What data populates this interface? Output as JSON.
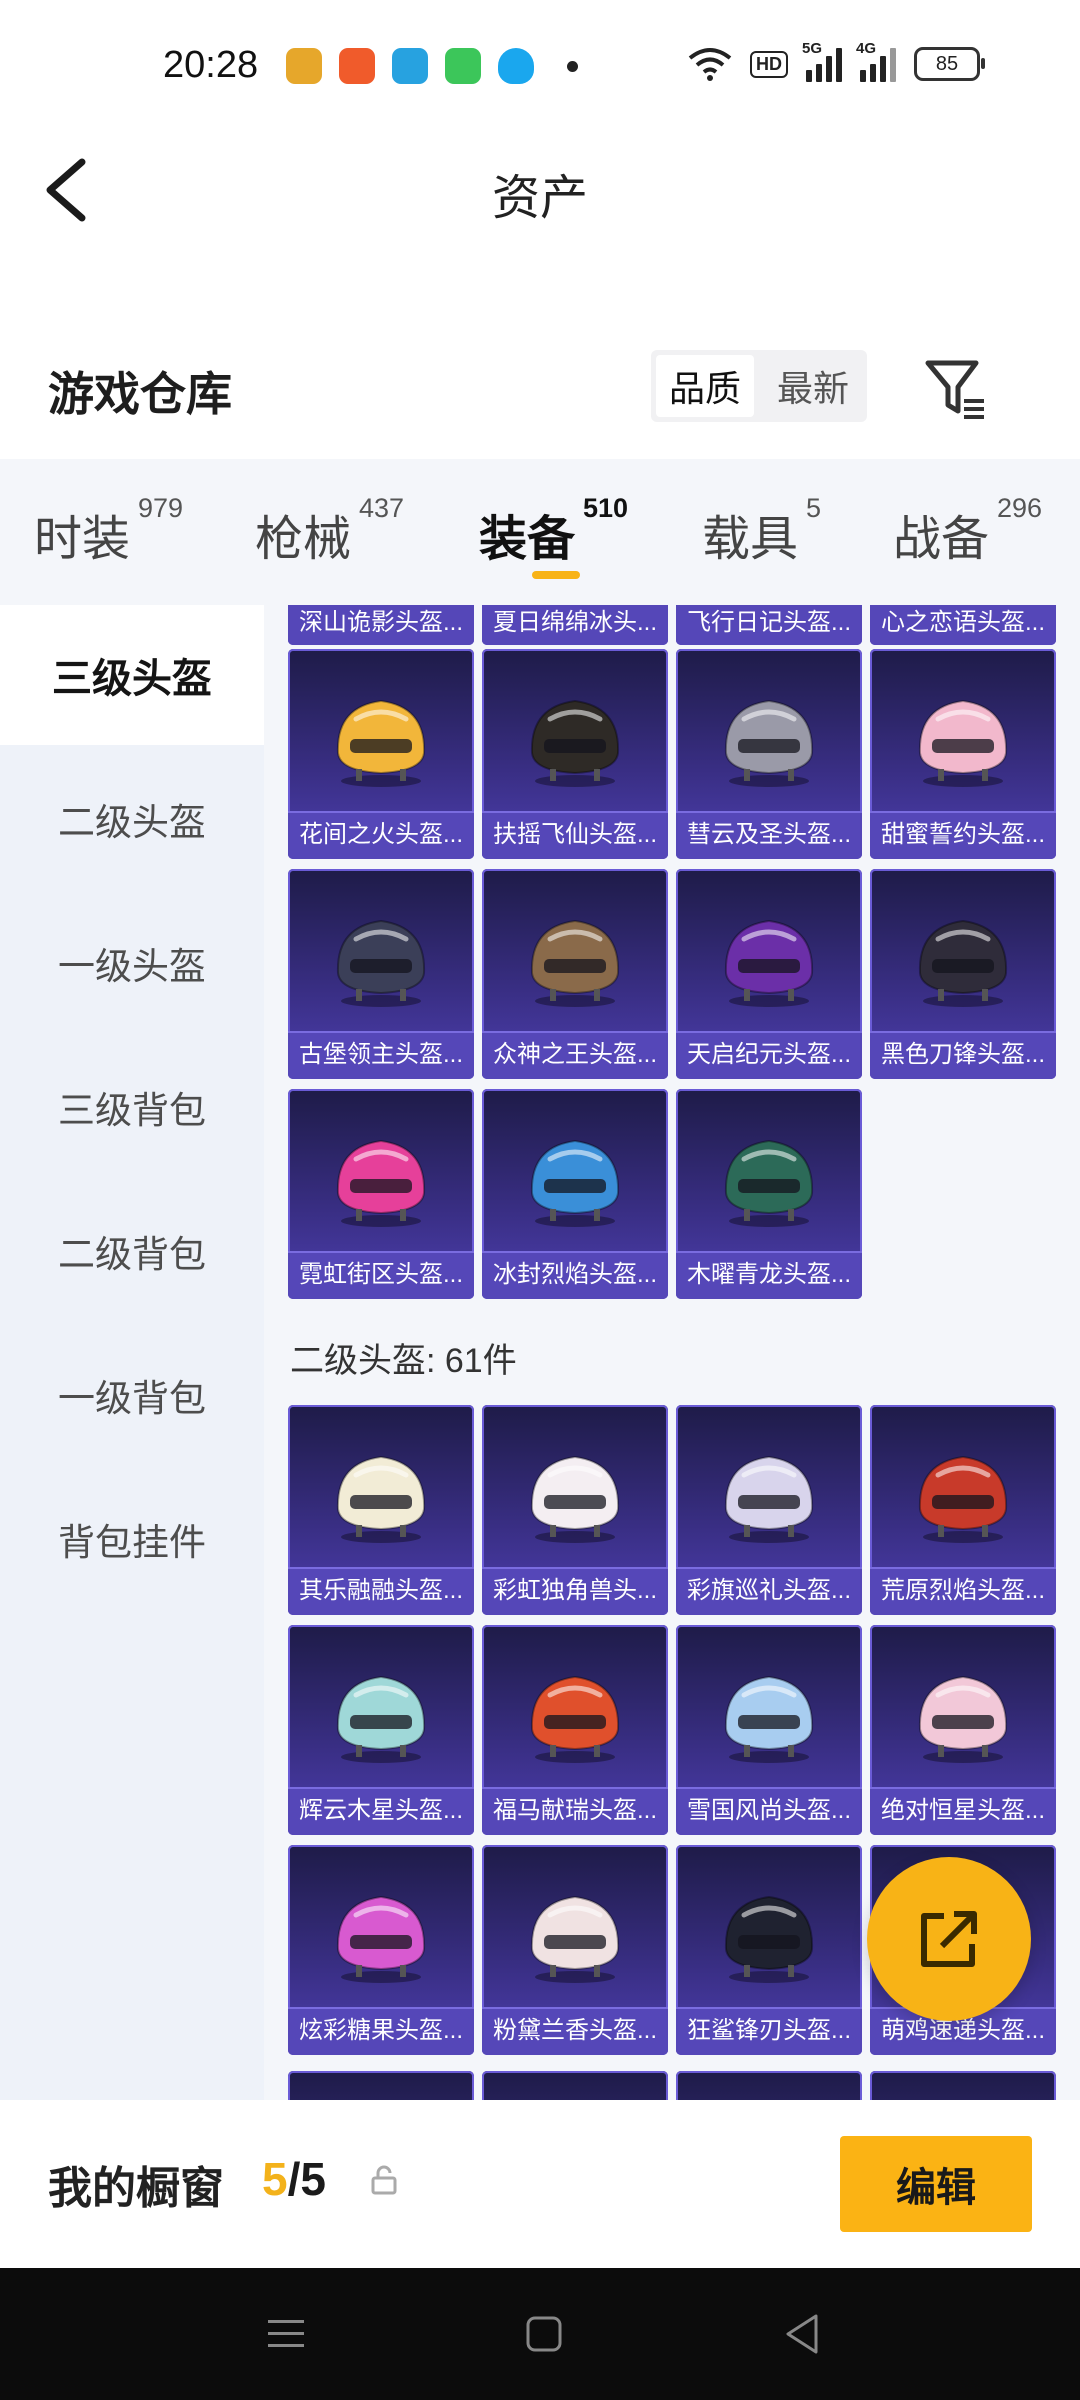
{
  "status_bar": {
    "time": "20:28",
    "hd_label": "HD",
    "signal_5g": "5G",
    "signal_4g": "4G",
    "battery": "85",
    "app_icon_colors": [
      "#e6a72b",
      "#f05b2b",
      "#27a2e0",
      "#3cc65a",
      "#1aa7ee"
    ]
  },
  "header": {
    "title": "资产"
  },
  "warehouse": {
    "title": "游戏仓库",
    "sort_options": [
      "品质",
      "最新"
    ],
    "active_sort": "品质"
  },
  "tabs": [
    {
      "label": "时装",
      "count": "979"
    },
    {
      "label": "枪械",
      "count": "437"
    },
    {
      "label": "装备",
      "count": "510"
    },
    {
      "label": "载具",
      "count": "5"
    },
    {
      "label": "战备",
      "count": "296"
    }
  ],
  "side_nav": [
    "三级头盔",
    "二级头盔",
    "一级头盔",
    "三级背包",
    "二级背包",
    "一级背包",
    "背包挂件"
  ],
  "partial_row_labels": [
    "深山诡影头盔...",
    "夏日绵绵冰头...",
    "飞行日记头盔...",
    "心之恋语头盔..."
  ],
  "level3_items": [
    {
      "name": "花间之火头盔...",
      "color": "#f2b63a"
    },
    {
      "name": "扶摇飞仙头盔...",
      "color": "#2e2a26"
    },
    {
      "name": "彗云及圣头盔...",
      "color": "#9a9aa8"
    },
    {
      "name": "甜蜜誓约头盔...",
      "color": "#f2b8cc"
    },
    {
      "name": "古堡领主头盔...",
      "color": "#3b3f58"
    },
    {
      "name": "众神之王头盔...",
      "color": "#8a6a4a"
    },
    {
      "name": "天启纪元头盔...",
      "color": "#6b2fa8"
    },
    {
      "name": "黑色刀锋头盔...",
      "color": "#2f2c3a"
    },
    {
      "name": "霓虹街区头盔...",
      "color": "#e6409a"
    },
    {
      "name": "冰封烈焰头盔...",
      "color": "#3a8fd8"
    },
    {
      "name": "木曜青龙头盔...",
      "color": "#2c6a58"
    }
  ],
  "level2_header": "二级头盔: 61件",
  "level2_items": [
    {
      "name": "其乐融融头盔...",
      "color": "#f2ecd6"
    },
    {
      "name": "彩虹独角兽头...",
      "color": "#f4eef2"
    },
    {
      "name": "彩旗巡礼头盔...",
      "color": "#d8d4ec"
    },
    {
      "name": "荒原烈焰头盔...",
      "color": "#c83a2a"
    },
    {
      "name": "辉云木星头盔...",
      "color": "#9fd8d8"
    },
    {
      "name": "福马献瑞头盔...",
      "color": "#e0502c"
    },
    {
      "name": "雪国风尚头盔...",
      "color": "#a8cdf0"
    },
    {
      "name": "绝对恒星头盔...",
      "color": "#f2c8d8"
    },
    {
      "name": "炫彩糖果头盔...",
      "color": "#d85ad0"
    },
    {
      "name": "粉黛兰香头盔...",
      "color": "#f0e2e2"
    },
    {
      "name": "狂鲨锋刃头盔...",
      "color": "#1f2230"
    },
    {
      "name": "萌鸡速递头盔...",
      "color": "#f0d24a"
    }
  ],
  "showcase": {
    "label": "我的橱窗",
    "current": "5",
    "separator": "/",
    "total": "5",
    "edit_label": "编辑"
  },
  "colors": {
    "accent": "#f8b316",
    "card_bg": "#3a2f86",
    "label_bg": "#5547b8"
  }
}
